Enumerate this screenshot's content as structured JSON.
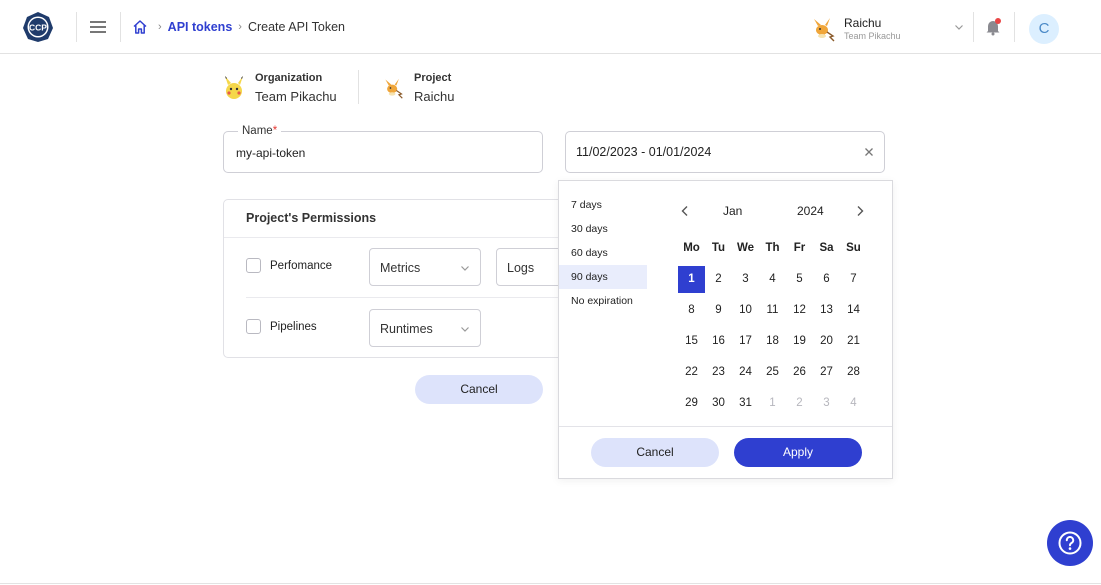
{
  "header": {
    "logo_text": "CCP",
    "breadcrumb": {
      "parent": "API tokens",
      "current": "Create API Token"
    },
    "user": {
      "name": "Raichu",
      "team": "Team Pikachu"
    },
    "avatar_letter": "C"
  },
  "context": {
    "organization": {
      "label": "Organization",
      "value": "Team Pikachu"
    },
    "project": {
      "label": "Project",
      "value": "Raichu"
    }
  },
  "form": {
    "name_label": "Name",
    "name_required_mark": "*",
    "name_value": "my-api-token",
    "date_range_value": "11/02/2023 - 01/01/2024"
  },
  "permissions": {
    "title": "Project's Permissions",
    "rows": [
      {
        "label": "Perfomance",
        "selects": [
          "Metrics",
          "Logs"
        ]
      },
      {
        "label": "Pipelines",
        "selects": [
          "Runtimes"
        ]
      }
    ]
  },
  "actions": {
    "cancel_label": "Cancel"
  },
  "datepicker": {
    "presets": [
      "7 days",
      "30 days",
      "60 days",
      "90 days",
      "No expiration"
    ],
    "active_preset": "90 days",
    "month": "Jan",
    "year": "2024",
    "weekdays": [
      "Mo",
      "Tu",
      "We",
      "Th",
      "Fr",
      "Sa",
      "Su"
    ],
    "weeks": [
      [
        "1",
        "2",
        "3",
        "4",
        "5",
        "6",
        "7"
      ],
      [
        "8",
        "9",
        "10",
        "11",
        "12",
        "13",
        "14"
      ],
      [
        "15",
        "16",
        "17",
        "18",
        "19",
        "20",
        "21"
      ],
      [
        "22",
        "23",
        "24",
        "25",
        "26",
        "27",
        "28"
      ],
      [
        "29",
        "30",
        "31",
        "1",
        "2",
        "3",
        "4"
      ]
    ],
    "selected_day": "1",
    "cancel_label": "Cancel",
    "apply_label": "Apply"
  },
  "colors": {
    "accent": "#2f3fd0",
    "accent_light": "#dde3fb",
    "required": "#e53935",
    "notification": "#e94646"
  },
  "icons": {
    "logo": "ccp-logo-icon",
    "menu": "hamburger-menu-icon",
    "home": "home-icon",
    "bell": "bell-icon",
    "help": "help-icon",
    "clear": "close-icon",
    "prev": "chevron-left-icon",
    "next": "chevron-right-icon"
  }
}
